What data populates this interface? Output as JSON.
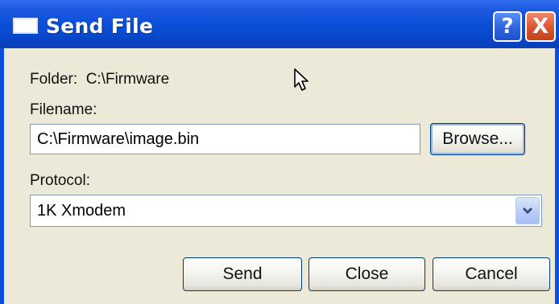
{
  "window": {
    "title": "Send File",
    "help_glyph": "?",
    "close_glyph": "X",
    "accent_color": "#0a4fd9"
  },
  "folder": {
    "label": "Folder:",
    "value": "C:\\Firmware"
  },
  "filename": {
    "label": "Filename:",
    "value": "C:\\Firmware\\image.bin",
    "browse_label": "Browse..."
  },
  "protocol": {
    "label": "Protocol:",
    "selected": "1K Xmodem"
  },
  "actions": {
    "send_label": "Send",
    "close_label": "Close",
    "cancel_label": "Cancel"
  },
  "icons": {
    "window_icon": "window-icon",
    "help": "help-icon",
    "close": "close-icon",
    "dropdown": "chevron-down-icon",
    "cursor": "mouse-pointer-icon"
  }
}
